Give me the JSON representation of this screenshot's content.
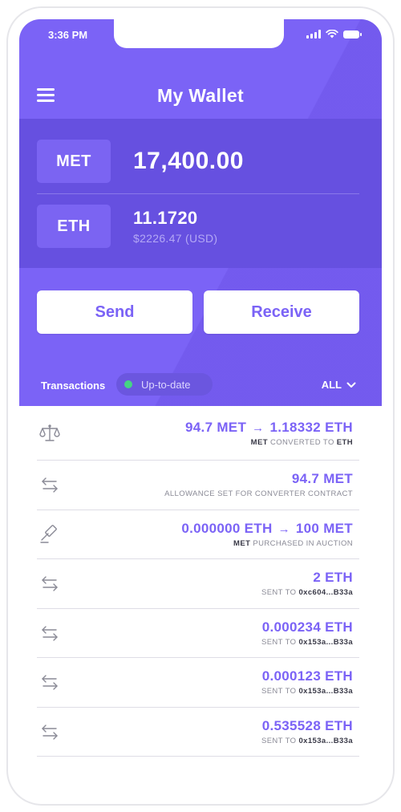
{
  "status_bar": {
    "time": "3:36 PM"
  },
  "header": {
    "title": "My Wallet"
  },
  "balances": {
    "met": {
      "symbol": "MET",
      "amount": "17,400.00"
    },
    "eth": {
      "symbol": "ETH",
      "amount": "11.1720",
      "usd": "$2226.47 (USD)"
    }
  },
  "actions": {
    "send": "Send",
    "receive": "Receive"
  },
  "transactions_header": {
    "title": "Transactions",
    "sync_status": "Up-to-date",
    "filter": "ALL"
  },
  "transactions": [
    {
      "icon": "balance-scale-icon",
      "amount_from": "94.7 MET",
      "arrow": "→",
      "amount_to": "1.18332 ETH",
      "desc_bold": "MET",
      "desc": "CONVERTED TO",
      "desc_bold2": "ETH"
    },
    {
      "icon": "transfer-arrows-icon",
      "amount": "94.7 MET",
      "desc": "ALLOWANCE SET FOR CONVERTER CONTRACT"
    },
    {
      "icon": "auction-gavel-icon",
      "amount_from": "0.000000 ETH",
      "arrow": "→",
      "amount_to": "100 MET",
      "desc_bold": "MET",
      "desc": "PURCHASED IN AUCTION"
    },
    {
      "icon": "transfer-arrows-icon",
      "amount": "2 ETH",
      "desc": "SENT TO",
      "desc_bold2": "0xc604...B33a"
    },
    {
      "icon": "transfer-arrows-icon",
      "amount": "0.000234 ETH",
      "desc": "SENT TO",
      "desc_bold2": "0x153a...B33a"
    },
    {
      "icon": "transfer-arrows-icon",
      "amount": "0.000123 ETH",
      "desc": "SENT TO",
      "desc_bold2": "0x153a...B33a"
    },
    {
      "icon": "transfer-arrows-icon",
      "amount": "0.535528 ETH",
      "desc": "SENT TO",
      "desc_bold2": "0x153a...B33a"
    }
  ],
  "colors": {
    "primary": "#7b63f6",
    "panel": "#6650e0",
    "sync_dot": "#45d483"
  }
}
